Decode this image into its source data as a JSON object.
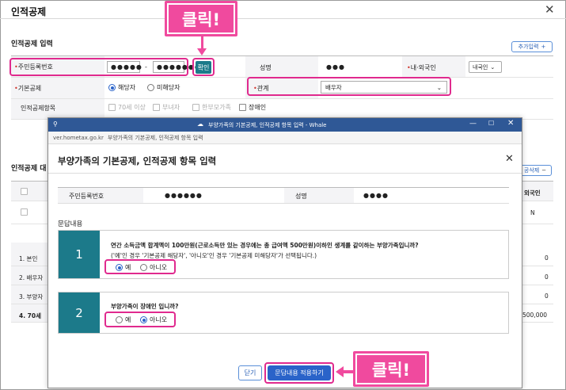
{
  "window": {
    "title": "인적공제",
    "close": "✕"
  },
  "input_section": {
    "title": "인적공제 입력",
    "add_button": "추가입력",
    "add_icon": "+",
    "rrn_label": "주민등록번호",
    "rrn_front": "●●●●●",
    "rrn_dash": "-",
    "rrn_back": "●●●●●●●",
    "confirm_button": "확인",
    "name_label": "성명",
    "name_value": "●●●",
    "nationality_label": "내·외국인",
    "nationality_value": "내국인",
    "basic_label": "기본공제",
    "basic_opt1": "해당자",
    "basic_opt2": "미해당자",
    "relation_label": "관계",
    "relation_value": "배우자",
    "items_label": "인적공제항목",
    "item1": "70세 이상",
    "item2": "부녀자",
    "item3": "한부모가족",
    "item4": "장애인"
  },
  "list_section": {
    "title": "인적공제 대",
    "delete_button": "공삭제",
    "col_foreign": "외국인",
    "row_n": "N",
    "rows": [
      "1. 본인",
      "2. 배우자",
      "3. 부양자",
      "4. 70세"
    ],
    "amounts": [
      "0",
      "0",
      "0",
      "500,000"
    ]
  },
  "popup": {
    "window_title": "부양가족의 기본공제, 인적공제 항목 입력 - Whale",
    "url_host": "ver.hometax.go.kr",
    "url_title": "부양가족의 기본공제, 인적공제 항목 입력",
    "heading": "부양가족의 기본공제, 인적공제 항목 입력",
    "rrn_label": "주민등록번호",
    "rrn_value": "●●●●●●",
    "name_label": "성명",
    "name_value": "●●●●",
    "qa_title": "문답내용",
    "q1_num": "1",
    "q1_text": "연간 소득금액 합계액이 100만원(근로소득만 있는 경우에는 총 급여액 500만원)이하인 생계를 같이하는 부양가족입니까?",
    "q1_note": "('예'인 경우 '기본공제 해당자', '아니오'인 경우 '기본공제 미해당자'가 선택됩니다.)",
    "q2_num": "2",
    "q2_text": "부양가족이 장애인 입니까?",
    "yes": "예",
    "no": "아니오",
    "close_button": "닫기",
    "apply_button": "문답내용 적용하기"
  },
  "callouts": {
    "top": "클릭!",
    "bottom": "클릭!"
  },
  "colors": {
    "highlight": "#e02a8e",
    "callout": "#f04a9e",
    "teal": "#1c7a8a",
    "whale": "#2f5896",
    "primary": "#2a63c9"
  }
}
